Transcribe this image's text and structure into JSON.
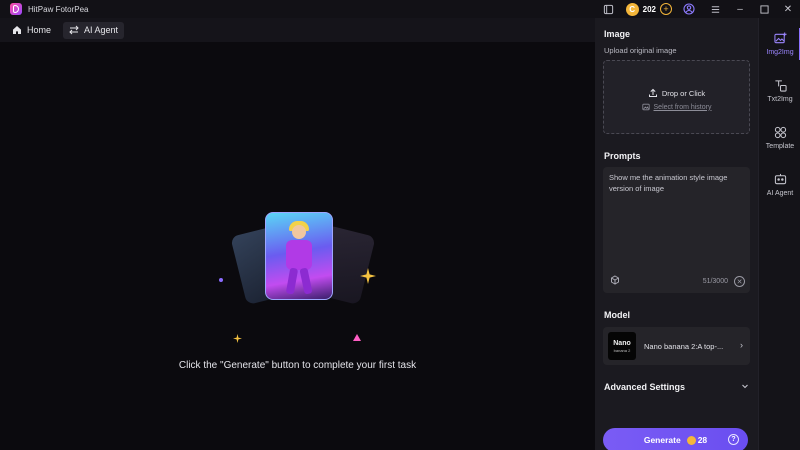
{
  "app": {
    "title": "HitPaw FotorPea"
  },
  "titlebar": {
    "credits": "202"
  },
  "nav": {
    "items": [
      {
        "label": "Home",
        "icon": "home-icon",
        "active": false
      },
      {
        "label": "AI Agent",
        "icon": "swap-icon",
        "active": true
      }
    ]
  },
  "canvas": {
    "hint": "Click the \"Generate\" button to complete your first task"
  },
  "panel": {
    "image": {
      "title": "Image",
      "subtitle": "Upload original image",
      "drop_label": "Drop or Click",
      "history_label": "Select from history"
    },
    "prompts": {
      "title": "Prompts",
      "value": "Show me the animation style image version of image",
      "count": "51/3000"
    },
    "model": {
      "title": "Model",
      "thumb_line1": "Nano",
      "thumb_line2": "banana 2",
      "name": "Nano banana 2:A top-..."
    },
    "advanced": {
      "title": "Advanced Settings"
    },
    "generate": {
      "label": "Generate",
      "cost": "28"
    }
  },
  "rail": {
    "items": [
      {
        "label": "Img2Img",
        "icon": "image-plus-icon",
        "active": true
      },
      {
        "label": "Txt2Img",
        "icon": "text-image-icon",
        "active": false
      },
      {
        "label": "Template",
        "icon": "template-icon",
        "active": false
      },
      {
        "label": "AI Agent",
        "icon": "ai-agent-icon",
        "active": false
      }
    ]
  },
  "colors": {
    "accent": "#7a5cf5",
    "coin": "#f4b63a",
    "bg": "#0b0a0e",
    "panel": "#1b1a20"
  }
}
